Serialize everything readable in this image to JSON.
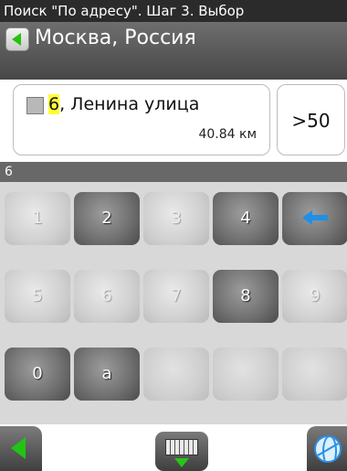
{
  "titlebar": {
    "title": "Поиск \"По адресу\". Шаг 3. Выбор"
  },
  "location": {
    "title": "Москва, Россия"
  },
  "result": {
    "house_number": "6",
    "street": ", Ленина улица",
    "distance": "40.84 км"
  },
  "more_button": {
    "label": ">50"
  },
  "input": {
    "value": "6"
  },
  "keyboard": {
    "keys": [
      {
        "label": "1",
        "enabled": false
      },
      {
        "label": "2",
        "enabled": true
      },
      {
        "label": "3",
        "enabled": false
      },
      {
        "label": "4",
        "enabled": true
      },
      {
        "label": "backspace",
        "enabled": true
      },
      {
        "label": "5",
        "enabled": false
      },
      {
        "label": "6",
        "enabled": false
      },
      {
        "label": "7",
        "enabled": false
      },
      {
        "label": "8",
        "enabled": true
      },
      {
        "label": "9",
        "enabled": false
      },
      {
        "label": "0",
        "enabled": true
      },
      {
        "label": "а",
        "enabled": true
      }
    ]
  },
  "icons": {
    "back": "back-arrow-icon",
    "backspace": "backspace-arrow-icon",
    "keyboard": "keyboard-icon",
    "globe": "globe-icon"
  },
  "colors": {
    "accent_green": "#27c20e",
    "highlight_yellow": "#ffff33",
    "accent_blue": "#1e90e8"
  }
}
